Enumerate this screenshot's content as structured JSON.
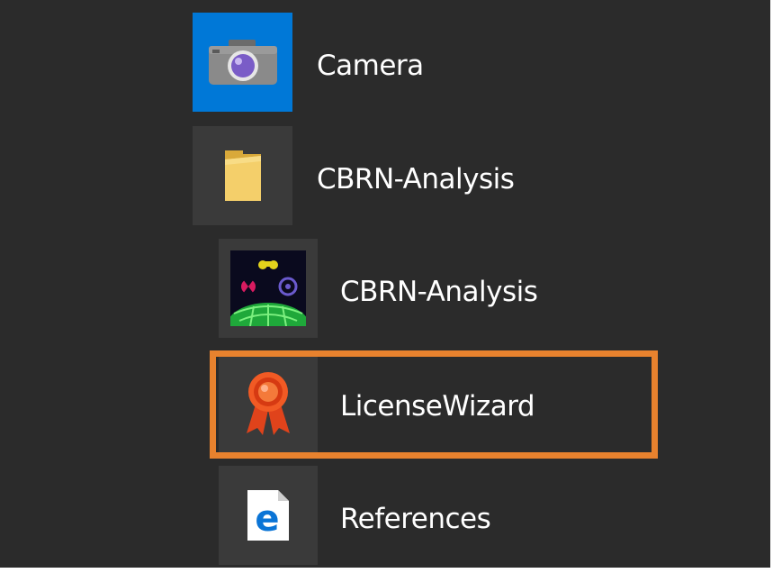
{
  "colors": {
    "panel_bg": "#2b2b2b",
    "tile_accent": "#0078d7",
    "tile_neutral": "#3a3a3a",
    "text": "#ffffff",
    "highlight": "#e8822e"
  },
  "start_menu": {
    "items": [
      {
        "label": "Camera",
        "icon": "camera-icon"
      },
      {
        "label": "CBRN-Analysis",
        "icon": "folder-icon"
      },
      {
        "label": "CBRN-Analysis",
        "icon": "cbrn-app-icon"
      },
      {
        "label": "LicenseWizard",
        "icon": "award-ribbon-icon",
        "highlighted": true
      },
      {
        "label": "References",
        "icon": "edge-document-icon"
      }
    ]
  }
}
